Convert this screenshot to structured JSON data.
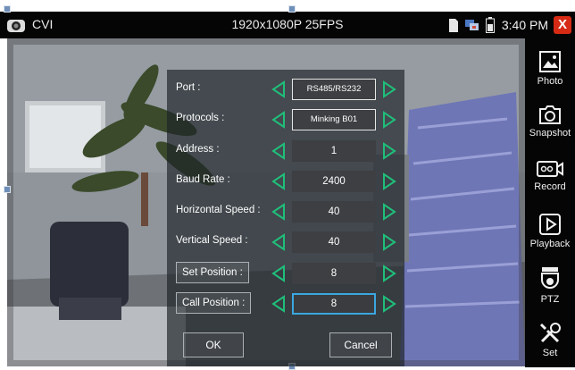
{
  "top_bar": {
    "app_label": "CVI",
    "resolution": "1920x1080P 25FPS",
    "time": "3:40 PM",
    "close_glyph": "X",
    "icons": [
      "camera-icon",
      "sd-card-icon",
      "network-icon",
      "battery-icon",
      "close-icon"
    ]
  },
  "sidebar": {
    "items": [
      {
        "label": "Photo",
        "icon": "photo-icon"
      },
      {
        "label": "Snapshot",
        "icon": "camera-icon"
      },
      {
        "label": "Record",
        "icon": "video-camera-icon"
      },
      {
        "label": "Playback",
        "icon": "play-icon"
      },
      {
        "label": "PTZ",
        "icon": "dome-camera-icon"
      },
      {
        "label": "Set",
        "icon": "tools-icon"
      }
    ]
  },
  "dialog": {
    "rows": [
      {
        "label": "Port :",
        "value": "RS485/RS232"
      },
      {
        "label": "Protocols :",
        "value": "Minking B01"
      },
      {
        "label": "Address :",
        "value": "1"
      },
      {
        "label": "Baud Rate :",
        "value": "2400"
      },
      {
        "label": "Horizontal Speed :",
        "value": "40"
      },
      {
        "label": "Vertical Speed :",
        "value": "40"
      },
      {
        "label": "Set Position :",
        "value": "8"
      },
      {
        "label": "Call Position :",
        "value": "8"
      }
    ],
    "ok_label": "OK",
    "cancel_label": "Cancel"
  },
  "colors": {
    "bar": "#050505",
    "arrow": "#1fbf7a",
    "selection": "#3aa7e0",
    "close": "#d62a14"
  }
}
